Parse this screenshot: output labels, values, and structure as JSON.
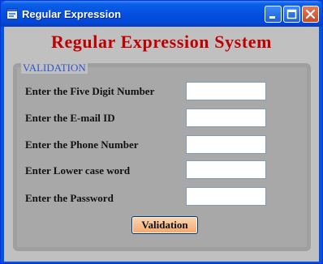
{
  "window": {
    "title": "Regular Expression",
    "controls": {
      "minimize_icon": "minimize-icon",
      "maximize_icon": "maximize-icon",
      "close_icon": "close-icon"
    }
  },
  "header": {
    "title": "Regular Expression System",
    "color": "#c00000"
  },
  "group": {
    "legend": "VALIDATION",
    "rows": [
      {
        "label": "Enter the Five Digit Number",
        "value": ""
      },
      {
        "label": "Enter the E-mail ID",
        "value": ""
      },
      {
        "label": "Enter the Phone Number",
        "value": ""
      },
      {
        "label": "Enter Lower case word",
        "value": ""
      },
      {
        "label": "Enter the Password",
        "value": ""
      }
    ],
    "button_label": "Validation"
  }
}
